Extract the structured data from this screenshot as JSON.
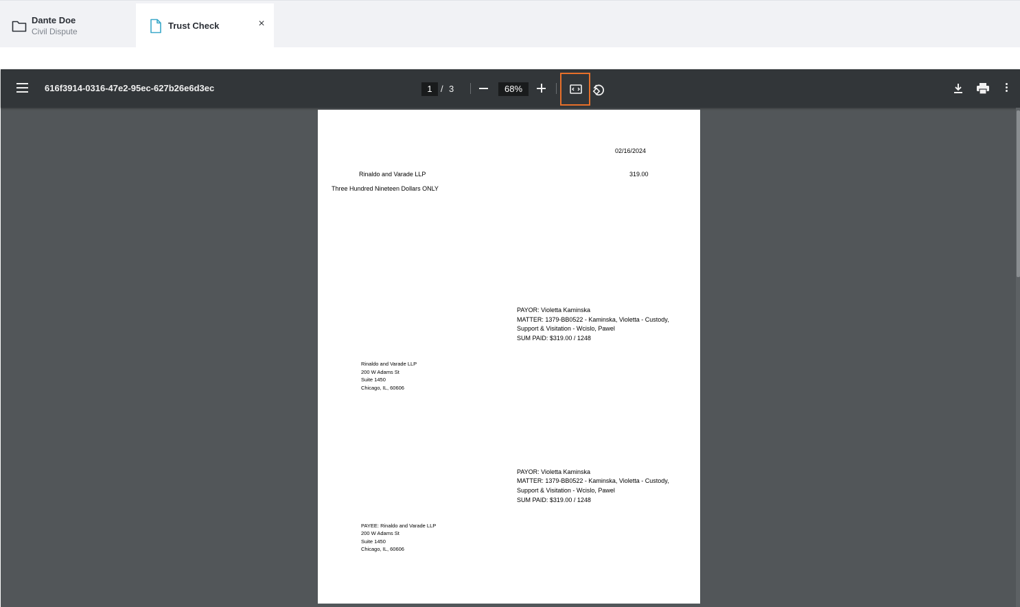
{
  "tabs": {
    "case": {
      "name": "Dante Doe",
      "sub": "Civil Dispute"
    },
    "document": {
      "label": "Trust Check",
      "close": "×"
    }
  },
  "viewer": {
    "filename": "616f3914-0316-47e2-95ec-627b26e6d3ec",
    "page_current": "1",
    "page_separator": "/",
    "page_total": "3",
    "zoom": "68%"
  },
  "document": {
    "date": "02/16/2024",
    "payee_name": "Rinaldo and Varade LLP",
    "amount": "319.00",
    "amount_words": "Three Hundred Nineteen Dollars ONLY",
    "stub1": {
      "payor": "PAYOR: Violetta Kaminska",
      "matter": "MATTER: 1379-BB0522 - Kaminska, Violetta - Custody,",
      "matter2": "Support & Visitation - Wcislo, Pawel",
      "sum": "SUM PAID: $319.00 / 1248"
    },
    "address1": [
      "Rinaldo and Varade LLP",
      "200 W Adams St",
      "Suite 1450",
      "Chicago, IL, 60606"
    ],
    "stub2": {
      "payor": "PAYOR: Violetta Kaminska",
      "matter": "MATTER: 1379-BB0522 - Kaminska, Violetta - Custody,",
      "matter2": "Support & Visitation - Wcislo, Pawel",
      "sum": "SUM PAID: $319.00 / 1248"
    },
    "address2": [
      "PAYEE: Rinaldo and Varade LLP",
      "200 W Adams St",
      "Suite 1450",
      "Chicago, IL, 60606"
    ]
  },
  "colors": {
    "toolbar": "#323639",
    "viewer_bg": "#525659",
    "highlight": "#e8702a",
    "doc_icon": "#3aa8c9"
  }
}
